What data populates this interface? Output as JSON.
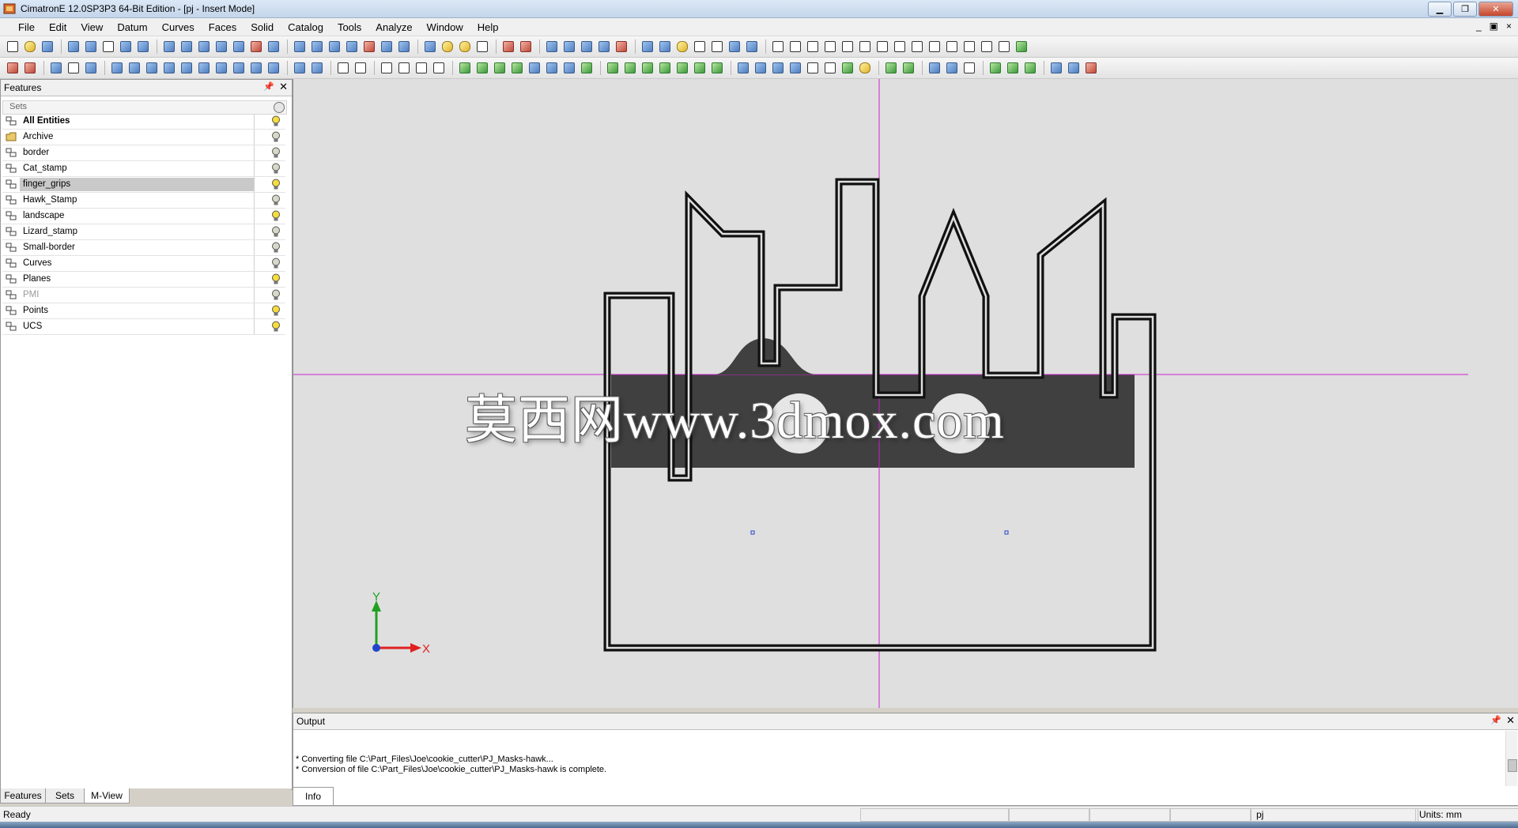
{
  "window": {
    "title": "CimatronE 12.0SP3P3  64-Bit Edition - [pj - Insert Mode]",
    "controls": [
      "minimize",
      "restore",
      "close"
    ]
  },
  "menu": {
    "items": [
      "File",
      "Edit",
      "View",
      "Datum",
      "Curves",
      "Faces",
      "Solid",
      "Catalog",
      "Tools",
      "Analyze",
      "Window",
      "Help"
    ],
    "mdi_controls": [
      "_",
      "▣",
      "×"
    ]
  },
  "features_panel": {
    "title": "Features",
    "column_header": "Sets",
    "rows": [
      {
        "label": "All Entities",
        "bold": true,
        "bulb": "on"
      },
      {
        "label": "Archive",
        "bulb": "off"
      },
      {
        "label": "border",
        "bulb": "off"
      },
      {
        "label": "Cat_stamp",
        "bulb": "off"
      },
      {
        "label": "finger_grips",
        "selected": true,
        "bulb": "on"
      },
      {
        "label": "Hawk_Stamp",
        "bulb": "off"
      },
      {
        "label": "landscape",
        "bulb": "on"
      },
      {
        "label": "Lizard_stamp",
        "bulb": "off"
      },
      {
        "label": "Small-border",
        "bulb": "off"
      },
      {
        "label": "Curves",
        "bulb": "off"
      },
      {
        "label": "Planes",
        "bulb": "on"
      },
      {
        "label": "PMI",
        "dim": true,
        "bulb": "off"
      },
      {
        "label": "Points",
        "bulb": "on"
      },
      {
        "label": "UCS",
        "bulb": "on"
      }
    ],
    "tabs": [
      "Features",
      "Sets",
      "M-View"
    ],
    "active_tab": "Sets"
  },
  "viewport": {
    "axis_labels": {
      "y": "Y",
      "x": "X"
    },
    "watermark": "莫西网www.3dmox.com",
    "colors": {
      "background": "#dfdfdf",
      "outline": "#111111",
      "band": "#404040",
      "crosshair": "#cc22cc",
      "axis_x": "#e02020",
      "axis_y": "#20a020"
    }
  },
  "output_panel": {
    "title": "Output",
    "lines": [
      "* Converting file C:\\Part_Files\\Joe\\cookie_cutter\\PJ_Masks-hawk...",
      "* Conversion of file C:\\Part_Files\\Joe\\cookie_cutter\\PJ_Masks-hawk is complete."
    ],
    "tab": "Info"
  },
  "status_bar": {
    "ready": "Ready",
    "model": "pj",
    "units": "Units: mm"
  }
}
